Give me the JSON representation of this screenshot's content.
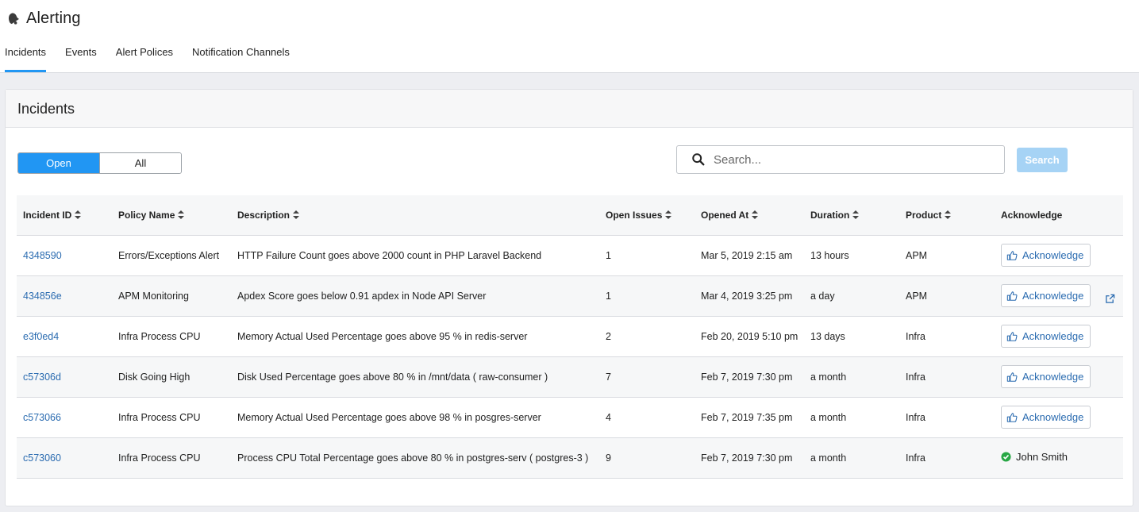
{
  "app": {
    "title": "Alerting",
    "icon": "bell-icon"
  },
  "tabs": [
    {
      "label": "Incidents",
      "active": true
    },
    {
      "label": "Events",
      "active": false
    },
    {
      "label": "Alert Polices",
      "active": false
    },
    {
      "label": "Notification Channels",
      "active": false
    }
  ],
  "panel": {
    "title": "Incidents"
  },
  "filter": {
    "open_label": "Open",
    "all_label": "All",
    "selected": "Open"
  },
  "search": {
    "placeholder": "Search...",
    "value": "",
    "button_label": "Search"
  },
  "table": {
    "columns": [
      "Incident ID",
      "Policy Name",
      "Description",
      "Open Issues",
      "Opened At",
      "Duration",
      "Product",
      "Acknowledge"
    ],
    "rows": [
      {
        "id": "4348590",
        "policy": "Errors/Exceptions Alert",
        "description": "HTTP Failure Count goes above 2000 count in PHP Laravel Backend",
        "open_issues": "1",
        "opened_at": "Mar 5, 2019 2:15 am",
        "duration": "13 hours",
        "product": "APM",
        "ack_label": "Acknowledge",
        "acknowledged_by": "",
        "external_link": false
      },
      {
        "id": "434856e",
        "policy": "APM Monitoring",
        "description": "Apdex Score goes below 0.91 apdex in Node API Server",
        "open_issues": "1",
        "opened_at": "Mar 4, 2019 3:25 pm",
        "duration": "a day",
        "product": "APM",
        "ack_label": "Acknowledge",
        "acknowledged_by": "",
        "external_link": true
      },
      {
        "id": "e3f0ed4",
        "policy": "Infra Process CPU",
        "description": "Memory Actual Used Percentage goes above 95 % in redis-server",
        "open_issues": "2",
        "opened_at": "Feb 20, 2019 5:10 pm",
        "duration": "13 days",
        "product": "Infra",
        "ack_label": "Acknowledge",
        "acknowledged_by": "",
        "external_link": false
      },
      {
        "id": "c57306d",
        "policy": "Disk Going High",
        "description": "Disk Used Percentage goes above 80 % in /mnt/data ( raw-consumer )",
        "open_issues": "7",
        "opened_at": "Feb 7, 2019 7:30 pm",
        "duration": "a month",
        "product": "Infra",
        "ack_label": "Acknowledge",
        "acknowledged_by": "",
        "external_link": false
      },
      {
        "id": "c573066",
        "policy": "Infra Process CPU",
        "description": "Memory Actual Used Percentage goes above 98 % in posgres-server",
        "open_issues": "4",
        "opened_at": "Feb 7, 2019 7:35 pm",
        "duration": "a month",
        "product": "Infra",
        "ack_label": "Acknowledge",
        "acknowledged_by": "",
        "external_link": false
      },
      {
        "id": "c573060",
        "policy": "Infra Process CPU",
        "description": "Process CPU Total Percentage goes above 80 % in postgres-serv ( postgres-3 )",
        "open_issues": "9",
        "opened_at": "Feb 7, 2019 7:30 pm",
        "duration": "a month",
        "product": "Infra",
        "ack_label": "",
        "acknowledged_by": "John Smith",
        "external_link": false
      }
    ]
  },
  "colors": {
    "accent": "#2196f3",
    "link": "#2a6bb0",
    "search_button": "#a6d3f5",
    "success": "#28a745"
  }
}
